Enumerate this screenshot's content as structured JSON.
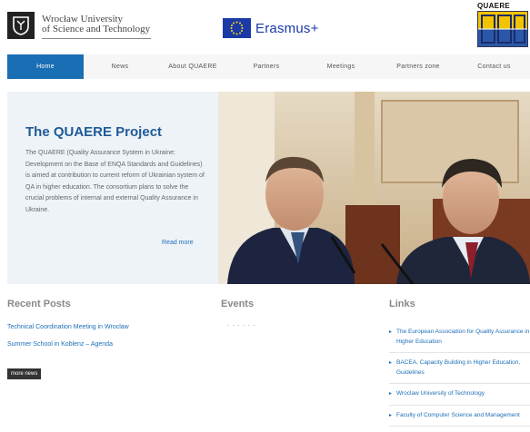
{
  "header": {
    "university_line1": "Wrocław University",
    "university_line2": "of Science and Technology",
    "erasmus_text": "Erasmus+",
    "quaere_title": "QUAERE"
  },
  "nav": {
    "items": [
      {
        "label": "Home",
        "active": true
      },
      {
        "label": "News"
      },
      {
        "label": "About QUAERE"
      },
      {
        "label": "Partners"
      },
      {
        "label": "Meetings"
      },
      {
        "label": "Partners zone"
      },
      {
        "label": "Contact us"
      }
    ]
  },
  "hero": {
    "title": "The QUAERE Project",
    "body": "The QUAERE (Quality Assurance System in Ukraine: Development on the Base of ENQA Standards and Guidelines) is aimed at contribution to current reform of Ukrainian system of QA in higher education. The consortium plans to solve the crucial problems of internal and external Quality Assurance in Ukraine.",
    "read_more": "Read more"
  },
  "recent_posts": {
    "title": "Recent Posts",
    "items": [
      "Technical Coordination Meeting in Wroclaw",
      "Summer School in Koblenz – Agenda"
    ],
    "more_label": "more news"
  },
  "events": {
    "title": "Events",
    "placeholder": "- - - - - -"
  },
  "links": {
    "title": "Links",
    "items": [
      "The European Association for Quality Assurance in Higher Education",
      "BACEA, Capacity Building in Higher Education, Guidelines",
      "Wroclaw University of Technology",
      "Faculty of Computer Science and Management"
    ]
  },
  "colors": {
    "accent": "#1a6eb4",
    "hero_bg": "#eef3f8",
    "eu_blue": "#1a3aa8"
  }
}
